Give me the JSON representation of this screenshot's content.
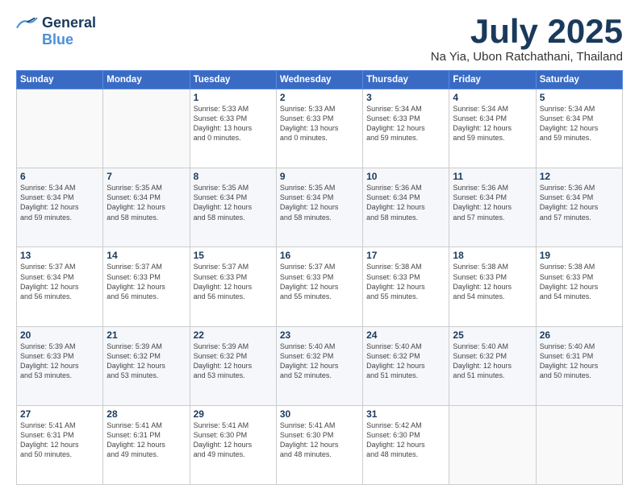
{
  "logo": {
    "line1": "General",
    "line2": "Blue"
  },
  "title": "July 2025",
  "location": "Na Yia, Ubon Ratchathani, Thailand",
  "days_of_week": [
    "Sunday",
    "Monday",
    "Tuesday",
    "Wednesday",
    "Thursday",
    "Friday",
    "Saturday"
  ],
  "weeks": [
    [
      {
        "day": "",
        "info": ""
      },
      {
        "day": "",
        "info": ""
      },
      {
        "day": "1",
        "info": "Sunrise: 5:33 AM\nSunset: 6:33 PM\nDaylight: 13 hours\nand 0 minutes."
      },
      {
        "day": "2",
        "info": "Sunrise: 5:33 AM\nSunset: 6:33 PM\nDaylight: 13 hours\nand 0 minutes."
      },
      {
        "day": "3",
        "info": "Sunrise: 5:34 AM\nSunset: 6:33 PM\nDaylight: 12 hours\nand 59 minutes."
      },
      {
        "day": "4",
        "info": "Sunrise: 5:34 AM\nSunset: 6:34 PM\nDaylight: 12 hours\nand 59 minutes."
      },
      {
        "day": "5",
        "info": "Sunrise: 5:34 AM\nSunset: 6:34 PM\nDaylight: 12 hours\nand 59 minutes."
      }
    ],
    [
      {
        "day": "6",
        "info": "Sunrise: 5:34 AM\nSunset: 6:34 PM\nDaylight: 12 hours\nand 59 minutes."
      },
      {
        "day": "7",
        "info": "Sunrise: 5:35 AM\nSunset: 6:34 PM\nDaylight: 12 hours\nand 58 minutes."
      },
      {
        "day": "8",
        "info": "Sunrise: 5:35 AM\nSunset: 6:34 PM\nDaylight: 12 hours\nand 58 minutes."
      },
      {
        "day": "9",
        "info": "Sunrise: 5:35 AM\nSunset: 6:34 PM\nDaylight: 12 hours\nand 58 minutes."
      },
      {
        "day": "10",
        "info": "Sunrise: 5:36 AM\nSunset: 6:34 PM\nDaylight: 12 hours\nand 58 minutes."
      },
      {
        "day": "11",
        "info": "Sunrise: 5:36 AM\nSunset: 6:34 PM\nDaylight: 12 hours\nand 57 minutes."
      },
      {
        "day": "12",
        "info": "Sunrise: 5:36 AM\nSunset: 6:34 PM\nDaylight: 12 hours\nand 57 minutes."
      }
    ],
    [
      {
        "day": "13",
        "info": "Sunrise: 5:37 AM\nSunset: 6:34 PM\nDaylight: 12 hours\nand 56 minutes."
      },
      {
        "day": "14",
        "info": "Sunrise: 5:37 AM\nSunset: 6:33 PM\nDaylight: 12 hours\nand 56 minutes."
      },
      {
        "day": "15",
        "info": "Sunrise: 5:37 AM\nSunset: 6:33 PM\nDaylight: 12 hours\nand 56 minutes."
      },
      {
        "day": "16",
        "info": "Sunrise: 5:37 AM\nSunset: 6:33 PM\nDaylight: 12 hours\nand 55 minutes."
      },
      {
        "day": "17",
        "info": "Sunrise: 5:38 AM\nSunset: 6:33 PM\nDaylight: 12 hours\nand 55 minutes."
      },
      {
        "day": "18",
        "info": "Sunrise: 5:38 AM\nSunset: 6:33 PM\nDaylight: 12 hours\nand 54 minutes."
      },
      {
        "day": "19",
        "info": "Sunrise: 5:38 AM\nSunset: 6:33 PM\nDaylight: 12 hours\nand 54 minutes."
      }
    ],
    [
      {
        "day": "20",
        "info": "Sunrise: 5:39 AM\nSunset: 6:33 PM\nDaylight: 12 hours\nand 53 minutes."
      },
      {
        "day": "21",
        "info": "Sunrise: 5:39 AM\nSunset: 6:32 PM\nDaylight: 12 hours\nand 53 minutes."
      },
      {
        "day": "22",
        "info": "Sunrise: 5:39 AM\nSunset: 6:32 PM\nDaylight: 12 hours\nand 53 minutes."
      },
      {
        "day": "23",
        "info": "Sunrise: 5:40 AM\nSunset: 6:32 PM\nDaylight: 12 hours\nand 52 minutes."
      },
      {
        "day": "24",
        "info": "Sunrise: 5:40 AM\nSunset: 6:32 PM\nDaylight: 12 hours\nand 51 minutes."
      },
      {
        "day": "25",
        "info": "Sunrise: 5:40 AM\nSunset: 6:32 PM\nDaylight: 12 hours\nand 51 minutes."
      },
      {
        "day": "26",
        "info": "Sunrise: 5:40 AM\nSunset: 6:31 PM\nDaylight: 12 hours\nand 50 minutes."
      }
    ],
    [
      {
        "day": "27",
        "info": "Sunrise: 5:41 AM\nSunset: 6:31 PM\nDaylight: 12 hours\nand 50 minutes."
      },
      {
        "day": "28",
        "info": "Sunrise: 5:41 AM\nSunset: 6:31 PM\nDaylight: 12 hours\nand 49 minutes."
      },
      {
        "day": "29",
        "info": "Sunrise: 5:41 AM\nSunset: 6:30 PM\nDaylight: 12 hours\nand 49 minutes."
      },
      {
        "day": "30",
        "info": "Sunrise: 5:41 AM\nSunset: 6:30 PM\nDaylight: 12 hours\nand 48 minutes."
      },
      {
        "day": "31",
        "info": "Sunrise: 5:42 AM\nSunset: 6:30 PM\nDaylight: 12 hours\nand 48 minutes."
      },
      {
        "day": "",
        "info": ""
      },
      {
        "day": "",
        "info": ""
      }
    ]
  ]
}
